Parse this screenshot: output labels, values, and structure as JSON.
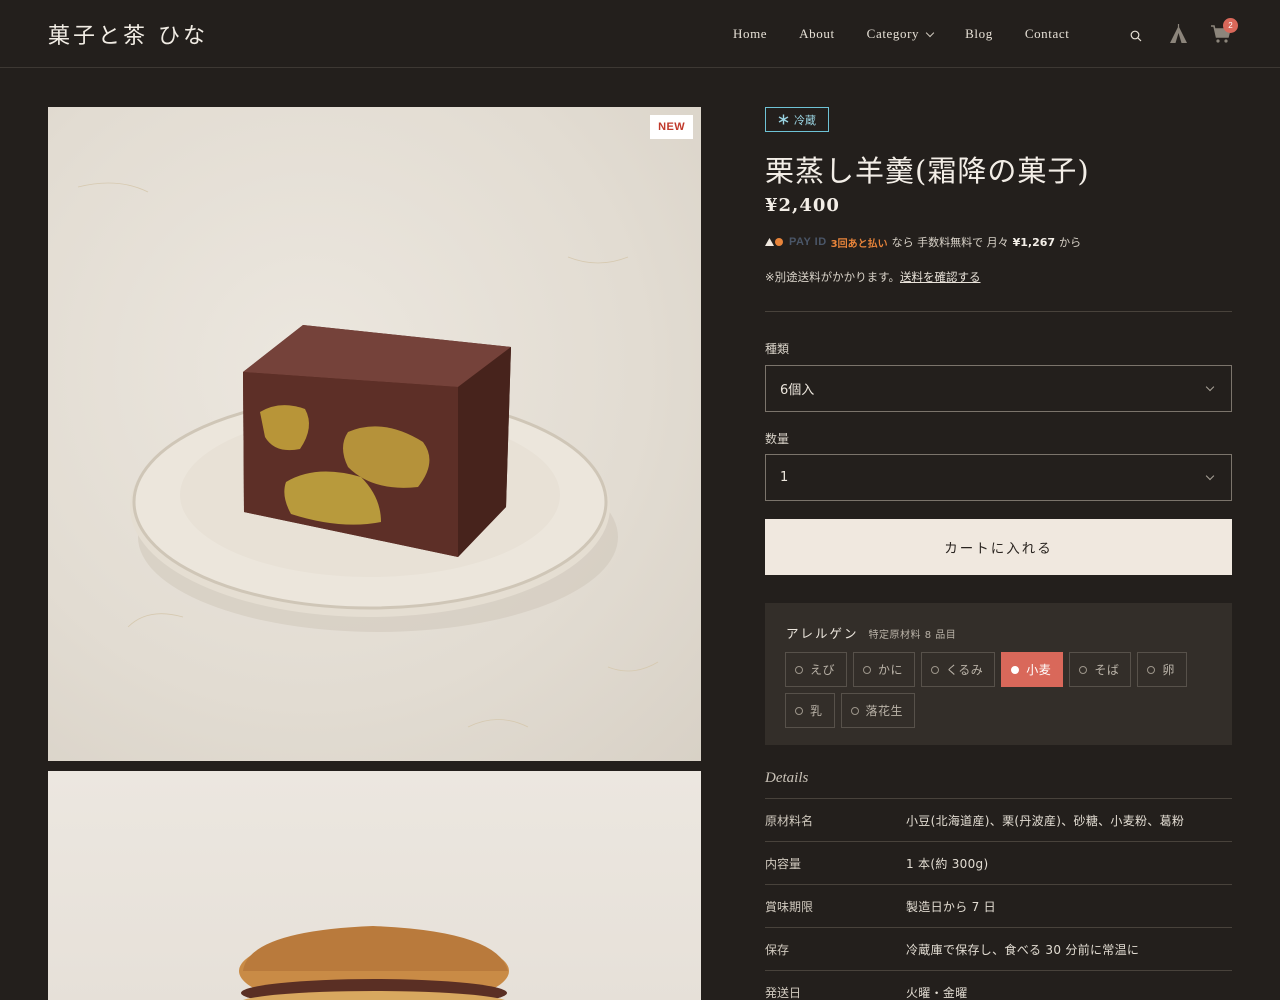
{
  "header": {
    "logo": "菓子と茶 ひな",
    "nav": [
      "Home",
      "About",
      "Category",
      "Blog",
      "Contact"
    ],
    "cart_count": "2",
    "icons": [
      "search-icon",
      "tent-icon",
      "cart-icon"
    ]
  },
  "images": {
    "new_badge": "NEW"
  },
  "product": {
    "storage_tag": "冷蔵",
    "title": "栗蒸し羊羹(霜降の菓子)",
    "price": "¥2,400",
    "paidy_logo": "PAY ID",
    "paidy_atobarai": "3回あと払い",
    "paidy_text": "なら 手数料無料で 月々",
    "paidy_amount": "¥1,267",
    "paidy_suffix": "から",
    "shipping_note": "※別途送料がかかります。",
    "shipping_link": "送料を確認する"
  },
  "form": {
    "type_label": "種類",
    "type_value": "6個入",
    "qty_label": "数量",
    "qty_value": "1",
    "cart_button": "カートに入れる"
  },
  "allergen": {
    "title": "アレルゲン",
    "subtitle": "特定原材料 8 品目",
    "items": [
      {
        "label": "えび",
        "active": false
      },
      {
        "label": "かに",
        "active": false
      },
      {
        "label": "くるみ",
        "active": false
      },
      {
        "label": "小麦",
        "active": true
      },
      {
        "label": "そば",
        "active": false
      },
      {
        "label": "卵",
        "active": false
      },
      {
        "label": "乳",
        "active": false
      },
      {
        "label": "落花生",
        "active": false
      }
    ]
  },
  "details": {
    "heading": "Details",
    "rows": [
      {
        "key": "原材料名",
        "value": "小豆(北海道産)、栗(丹波産)、砂糖、小麦粉、葛粉"
      },
      {
        "key": "内容量",
        "value": "1 本(約 300g)"
      },
      {
        "key": "賞味期限",
        "value": "製造日から 7 日"
      },
      {
        "key": "保存",
        "value": "冷蔵庫で保存し、食べる 30 分前に常温に"
      },
      {
        "key": "発送日",
        "value": "火曜・金曜"
      }
    ]
  },
  "colors": {
    "background": "#231f1c",
    "accent": "#d9685a",
    "cart_button": "#f0e8df",
    "tag_border": "#6ec3d6"
  }
}
